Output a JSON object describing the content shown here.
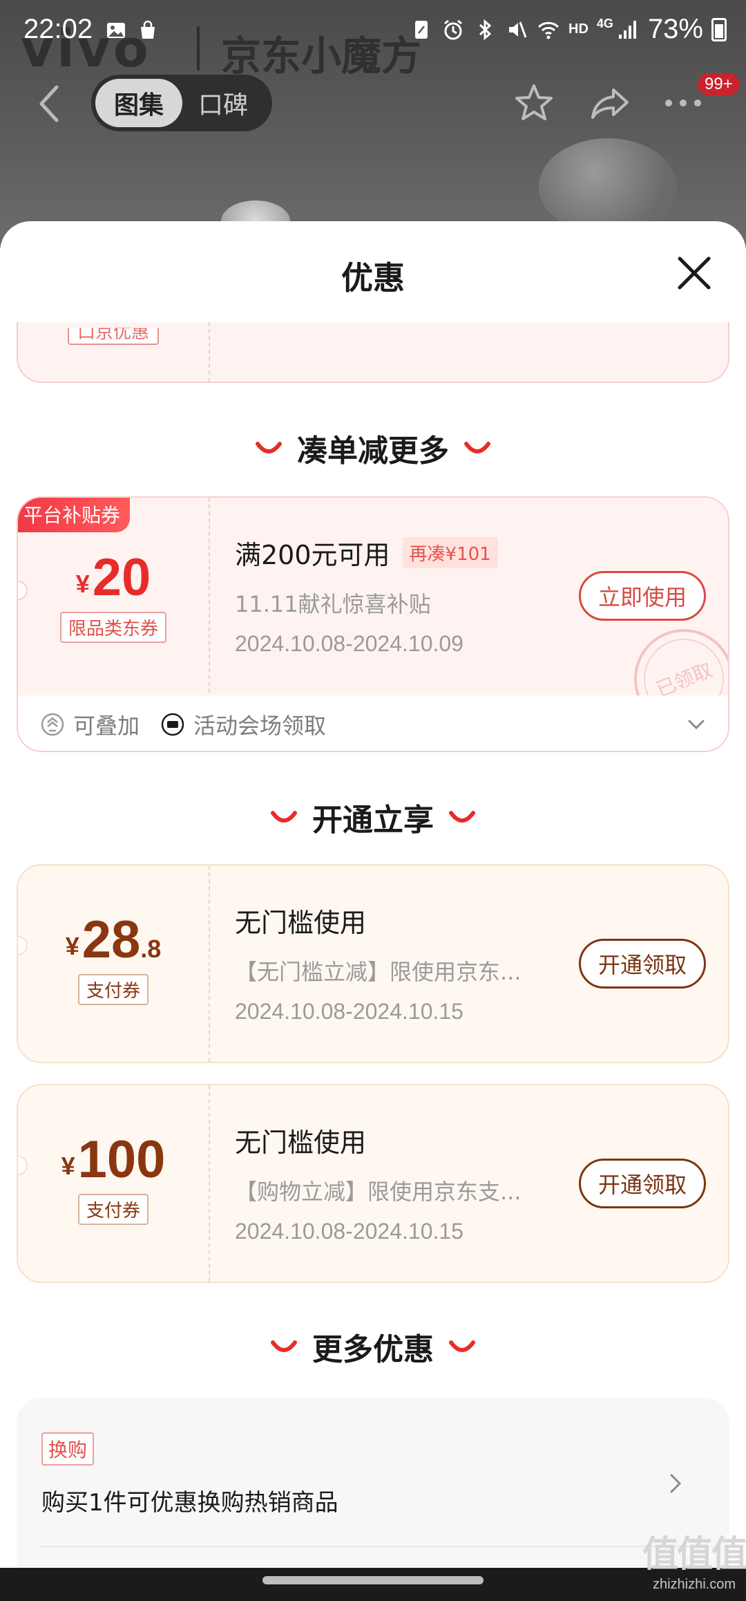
{
  "status_bar": {
    "time": "22:02",
    "network_label": "HD",
    "signal_label": "4G",
    "battery_percent": "73%"
  },
  "background": {
    "brand_text": "vivo",
    "shop_text": "京东小魔方"
  },
  "header": {
    "tabs": [
      {
        "label": "图集",
        "active": true
      },
      {
        "label": "口碑",
        "active": false
      }
    ],
    "cart_badge": "99+"
  },
  "sheet": {
    "title": "优惠",
    "top_partial_tag": "口京优惠"
  },
  "sections": [
    {
      "title": "凑单减更多"
    },
    {
      "title": "开通立享"
    },
    {
      "title": "更多优惠"
    }
  ],
  "coupon_platform": {
    "ribbon": "平台补贴券",
    "currency": "¥",
    "amount": "20",
    "type_tag": "限品类东券",
    "condition": "满200元可用",
    "gap_tag": "再凑¥101",
    "subtitle": "11.11献礼惊喜补贴",
    "date_range": "2024.10.08-2024.10.09",
    "action": "立即使用",
    "stamp": "已领取",
    "stackable": "可叠加",
    "source": "活动会场领取"
  },
  "coupon_pay_1": {
    "currency": "¥",
    "amount_int": "28",
    "amount_dec": ".8",
    "type_tag": "支付券",
    "condition": "无门槛使用",
    "subtitle": "【无门槛立减】限使用京东...",
    "date_range": "2024.10.08-2024.10.15",
    "action": "开通领取"
  },
  "coupon_pay_2": {
    "currency": "¥",
    "amount": "100",
    "type_tag": "支付券",
    "condition": "无门槛使用",
    "subtitle": "【购物立减】限使用京东支...",
    "date_range": "2024.10.08-2024.10.15",
    "action": "开通领取"
  },
  "more_offer": {
    "tag": "换购",
    "text": "购买1件可优惠换购热销商品"
  },
  "watermark": {
    "logo": "值值值",
    "url": "zhizhizhi.com"
  },
  "colors": {
    "accent_red": "#e62d2b",
    "accent_brown": "#8a3610",
    "ribbon_red": "#f23846"
  }
}
